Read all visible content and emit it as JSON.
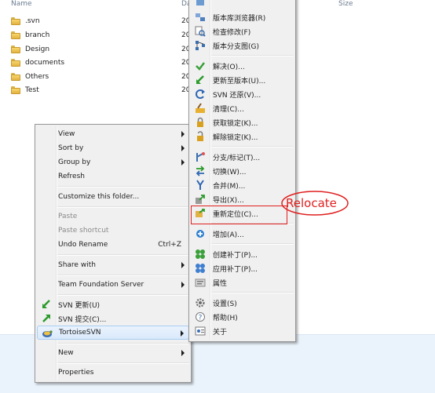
{
  "columns": {
    "name": "Name",
    "date": "Da",
    "size": "Size"
  },
  "files": [
    {
      "name": ".svn",
      "date": "20"
    },
    {
      "name": "branch",
      "date": "20"
    },
    {
      "name": "Design",
      "date": "20"
    },
    {
      "name": "documents",
      "date": "20"
    },
    {
      "name": "Others",
      "date": "20"
    },
    {
      "name": "Test",
      "date": "20"
    }
  ],
  "context_menu": {
    "items": [
      {
        "label": "View"
      },
      {
        "label": "Sort by"
      },
      {
        "label": "Group by"
      },
      {
        "label": "Refresh"
      },
      {
        "label": "Customize this folder..."
      },
      {
        "label": "Paste"
      },
      {
        "label": "Paste shortcut"
      },
      {
        "label": "Undo Rename",
        "shortcut": "Ctrl+Z"
      },
      {
        "label": "Share with"
      },
      {
        "label": "Team Foundation Server"
      },
      {
        "label": "SVN 更新(U)"
      },
      {
        "label": "SVN 提交(C)..."
      },
      {
        "label": "TortoiseSVN"
      },
      {
        "label": "New"
      },
      {
        "label": "Properties"
      }
    ]
  },
  "submenu": {
    "items": [
      {
        "label": "版本库浏览器(R)"
      },
      {
        "label": "检查修改(F)"
      },
      {
        "label": "版本分支图(G)"
      },
      {
        "label": "解决(O)..."
      },
      {
        "label": "更新至版本(U)..."
      },
      {
        "label": "SVN 还原(V)..."
      },
      {
        "label": "清理(C)..."
      },
      {
        "label": "获取锁定(K)..."
      },
      {
        "label": "解除锁定(K)..."
      },
      {
        "label": "分支/标记(T)..."
      },
      {
        "label": "切换(W)..."
      },
      {
        "label": "合并(M)..."
      },
      {
        "label": "导出(X)..."
      },
      {
        "label": "重新定位(C)..."
      },
      {
        "label": "增加(A)..."
      },
      {
        "label": "创建补丁(P)..."
      },
      {
        "label": "应用补丁(P)..."
      },
      {
        "label": "属性"
      },
      {
        "label": "设置(S)"
      },
      {
        "label": "帮助(H)"
      },
      {
        "label": "关于"
      }
    ]
  },
  "annotation": {
    "text": "Relocate",
    "color": "#e02020"
  }
}
